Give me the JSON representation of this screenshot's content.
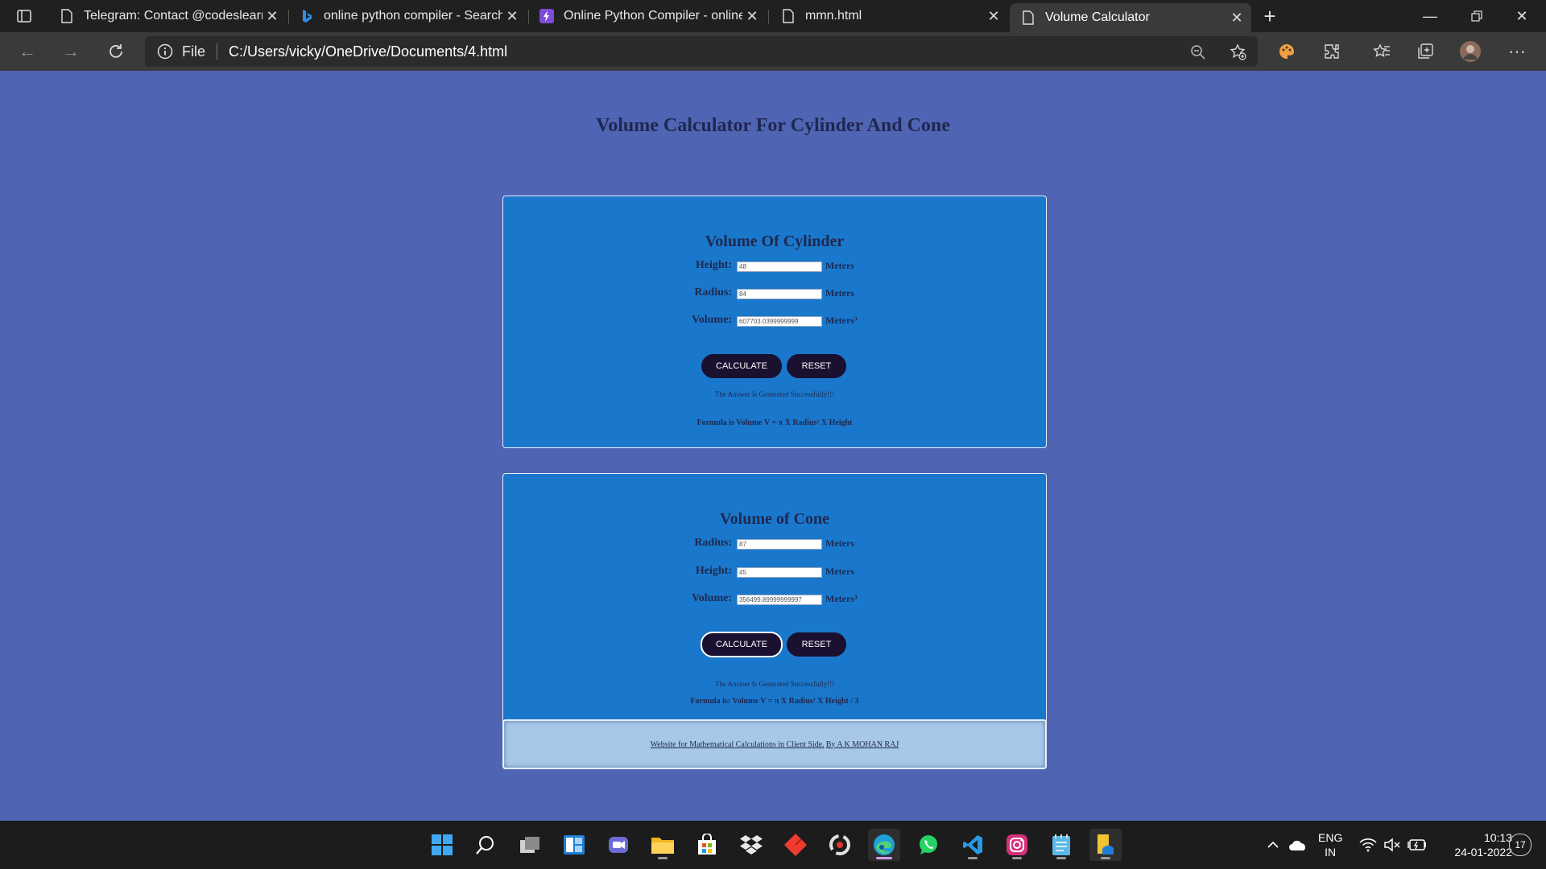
{
  "browser": {
    "tabs": [
      {
        "title": "Telegram: Contact @codeslearni",
        "icon": "page-icon",
        "active": false
      },
      {
        "title": "online python compiler - Search",
        "icon": "bing-icon",
        "active": false
      },
      {
        "title": "Online Python Compiler - online",
        "icon": "lightning-icon",
        "active": false
      },
      {
        "title": "mmn.html",
        "icon": "page-icon",
        "active": false
      },
      {
        "title": "Volume Calculator",
        "icon": "page-icon",
        "active": true
      }
    ],
    "address": {
      "scheme": "File",
      "url": "C:/Users/vicky/OneDrive/Documents/4.html"
    }
  },
  "page": {
    "title": "Volume Calculator For Cylinder And Cone",
    "cylinder": {
      "heading": "Volume Of Cylinder",
      "height_label": "Height:",
      "height_value": "48",
      "height_unit": "Meters",
      "radius_label": "Radius:",
      "radius_value": "84",
      "radius_unit": "Meters",
      "volume_label": "Volume:",
      "volume_value": "607703.0399999999",
      "volume_unit": "Meters³",
      "calculate_label": "CALCULATE",
      "reset_label": "RESET",
      "message": "The Answer Is Generated Successfully!!!",
      "formula": "Formula is Volume V = π X Radius² X Height"
    },
    "cone": {
      "heading": "Volume of Cone",
      "radius_label": "Radius:",
      "radius_value": "87",
      "radius_unit": "Meters",
      "height_label": "Height:",
      "height_value": "45",
      "height_unit": "Meters",
      "volume_label": "Volume:",
      "volume_value": "356499.89999999997",
      "volume_unit": "Meters³",
      "calculate_label": "CALCULATE",
      "reset_label": "RESET",
      "message": "The Answer Is Generated Successfully!!!",
      "formula": "Formula is: Volume V = π X Radius² X Height / 3"
    },
    "footer": {
      "link1": "Website for Mathematical Calculations in Client Side.",
      "link2": "By A K MOHAN RAJ"
    }
  },
  "taskbar": {
    "apps": [
      "start",
      "search",
      "task-view",
      "widgets",
      "teams-chat",
      "file-explorer",
      "microsoft-store",
      "dropbox",
      "git-app",
      "recorder",
      "edge",
      "whatsapp",
      "vscode",
      "instagram",
      "notepad",
      "file-manager"
    ],
    "language_line1": "ENG",
    "language_line2": "IN",
    "time": "10:13",
    "date": "24-01-2022",
    "notification_count": "17"
  },
  "colors": {
    "page_bg": "#5064b4",
    "panel_bg": "#1a78cc",
    "button_bg": "#1a1030",
    "footer_bg": "#a8c8e8",
    "heading_text": "#1e2850"
  }
}
